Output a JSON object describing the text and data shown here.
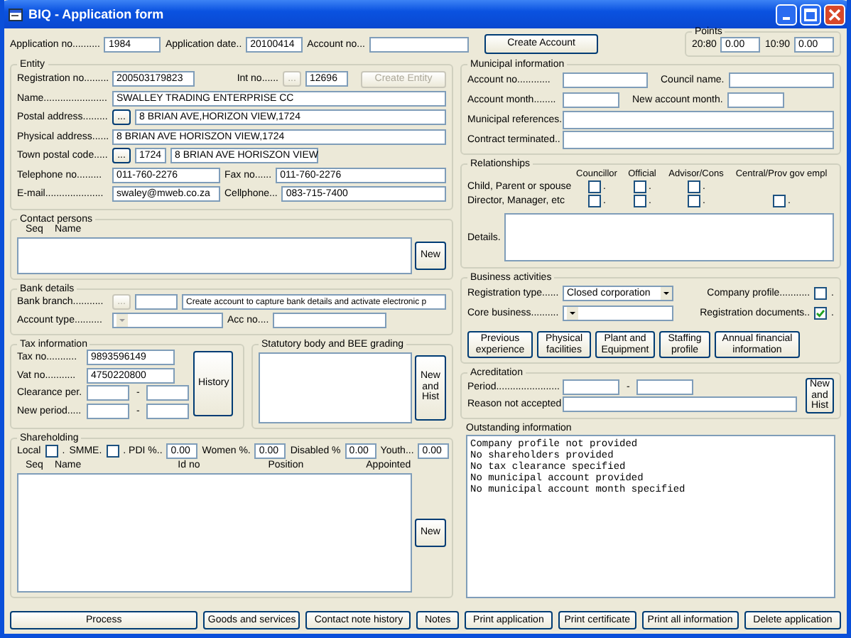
{
  "window": {
    "title": "BIQ - Application form"
  },
  "header": {
    "fields": [
      {
        "label": "Application no..........",
        "value": "1984"
      },
      {
        "label": "Application date..",
        "value": "20100414"
      },
      {
        "label": "Account no..."
      }
    ],
    "create_button": "Create Account"
  },
  "points": {
    "title": "Points",
    "items": [
      {
        "label": "20:80",
        "value": "0.00"
      },
      {
        "label": "10:90",
        "value": "0.00"
      }
    ]
  },
  "entity": {
    "title": "Entity",
    "registration": {
      "label": "Registration no.........",
      "value": "200503179823"
    },
    "int_no": {
      "label": "Int no......",
      "browse": "...",
      "browse_disabled": true,
      "value": "12696"
    },
    "create_button": {
      "label": "Create Entity",
      "disabled": true
    },
    "name": {
      "label": "Name.......................",
      "value": "SWALLEY TRADING ENTERPRISE CC"
    },
    "postal": {
      "label": "Postal address.........",
      "browse": "...",
      "browse_disabled": false,
      "value": "8 BRIAN AVE,HORIZON VIEW,1724"
    },
    "physical": {
      "label": "Physical address......",
      "value": "8 BRIAN AVE HORISZON VIEW,1724"
    },
    "town": {
      "label": "Town postal code.....",
      "browse": "...",
      "browse_disabled": false,
      "code": "1724",
      "value": "8 BRIAN AVE HORISZON VIEW"
    },
    "telephone": {
      "label": "Telephone no.........",
      "value": "011-760-2276"
    },
    "fax": {
      "label": "Fax no......",
      "value": "011-760-2276"
    },
    "email": {
      "label": "E-mail.....................",
      "value": "swaley@mweb.co.za"
    },
    "cellphone": {
      "label": "Cellphone...",
      "value": "083-715-7400"
    }
  },
  "contact_persons": {
    "title": "Contact persons",
    "columns": [
      "Seq",
      "Name"
    ],
    "new_button": "New"
  },
  "bank": {
    "title": "Bank details",
    "branch": {
      "label": "Bank branch...........",
      "browse": "...",
      "browse_disabled": true,
      "message": "Create account to capture bank details and activate electronic p"
    },
    "account_type": {
      "label": "Account type.........."
    },
    "acc_no": {
      "label": "Acc no...."
    }
  },
  "tax": {
    "title": "Tax information",
    "fields": [
      {
        "kind": "single",
        "label": "Tax no...........",
        "value": "9893596149"
      },
      {
        "kind": "single",
        "label": "Vat no...........",
        "value": "4750220800"
      },
      {
        "kind": "range",
        "label": "Clearance per.",
        "separator": "-"
      },
      {
        "kind": "range",
        "label": "New period.....",
        "separator": "-"
      }
    ],
    "history_button": "History"
  },
  "statutory": {
    "title": "Statutory body and BEE grading",
    "new_button": "New and Hist"
  },
  "shareholding": {
    "title": "Shareholding",
    "items": [
      {
        "kind": "checkbox",
        "label": "Local",
        "checked": false,
        "suffix": "."
      },
      {
        "kind": "checkbox",
        "label": "SMME.",
        "checked": false
      },
      {
        "kind": "field",
        "label": ". PDI %..",
        "value": "0.00"
      },
      {
        "kind": "field",
        "label": "Women %.",
        "value": "0.00"
      },
      {
        "kind": "field",
        "label": "Disabled %",
        "value": "0.00"
      },
      {
        "kind": "field",
        "label": "Youth...",
        "value": "0.00"
      }
    ],
    "columns": [
      "Seq",
      "Name",
      "Id no",
      "Position",
      "Appointed"
    ],
    "new_button": "New"
  },
  "municipal": {
    "title": "Municipal information",
    "account_no": {
      "label": "Account no............"
    },
    "council_name": {
      "label": "Council name."
    },
    "account_month": {
      "label": "Account month........"
    },
    "new_account_month": {
      "label": "New account month."
    },
    "references": {
      "label": "Municipal references."
    },
    "terminated": {
      "label": "Contract terminated.."
    }
  },
  "relationships": {
    "title": "Relationships",
    "columns": [
      "Councillor",
      "Official",
      "Advisor/Cons",
      "Central/Prov gov empl"
    ],
    "rows": [
      {
        "label": "Child, Parent or spouse",
        "cells": [
          {
            "checked": false,
            "suffix": "."
          },
          {
            "checked": false,
            "suffix": "."
          },
          {
            "checked": false,
            "suffix": "."
          }
        ]
      },
      {
        "label": "Director, Manager, etc",
        "cells": [
          {
            "checked": false,
            "suffix": "."
          },
          {
            "checked": false,
            "suffix": "."
          },
          {
            "checked": false,
            "suffix": "."
          },
          {
            "checked": false,
            "suffix": "."
          }
        ]
      }
    ],
    "details_label": "Details."
  },
  "business": {
    "title": "Business activities",
    "registration_type": {
      "label": "Registration type......",
      "value": "Closed corporation"
    },
    "core_business": {
      "label": "Core business.........."
    },
    "company_profile": {
      "label": "Company profile...........",
      "checked": false,
      "suffix": "."
    },
    "registration_documents": {
      "label": "Registration documents..",
      "checked": true,
      "suffix": "."
    },
    "buttons": [
      "Previous experience",
      "Physical facilities",
      "Plant and Equipment",
      "Staffing profile",
      "Annual financial information"
    ]
  },
  "acreditation": {
    "title": "Acreditation",
    "period": {
      "label": "Period.......................",
      "separator": "-"
    },
    "reason": {
      "label": "Reason not accepted"
    },
    "new_button": "New and Hist"
  },
  "outstanding": {
    "title": "Outstanding information",
    "lines": [
      "Company profile not provided",
      "No shareholders provided",
      "No tax clearance specified",
      "No municipal account provided",
      "No municipal account month specified"
    ]
  },
  "actions": [
    "Process",
    "Goods and services",
    "Contact note history",
    "Notes",
    "Print application",
    "Print certificate",
    "Print all information",
    "Delete application"
  ]
}
